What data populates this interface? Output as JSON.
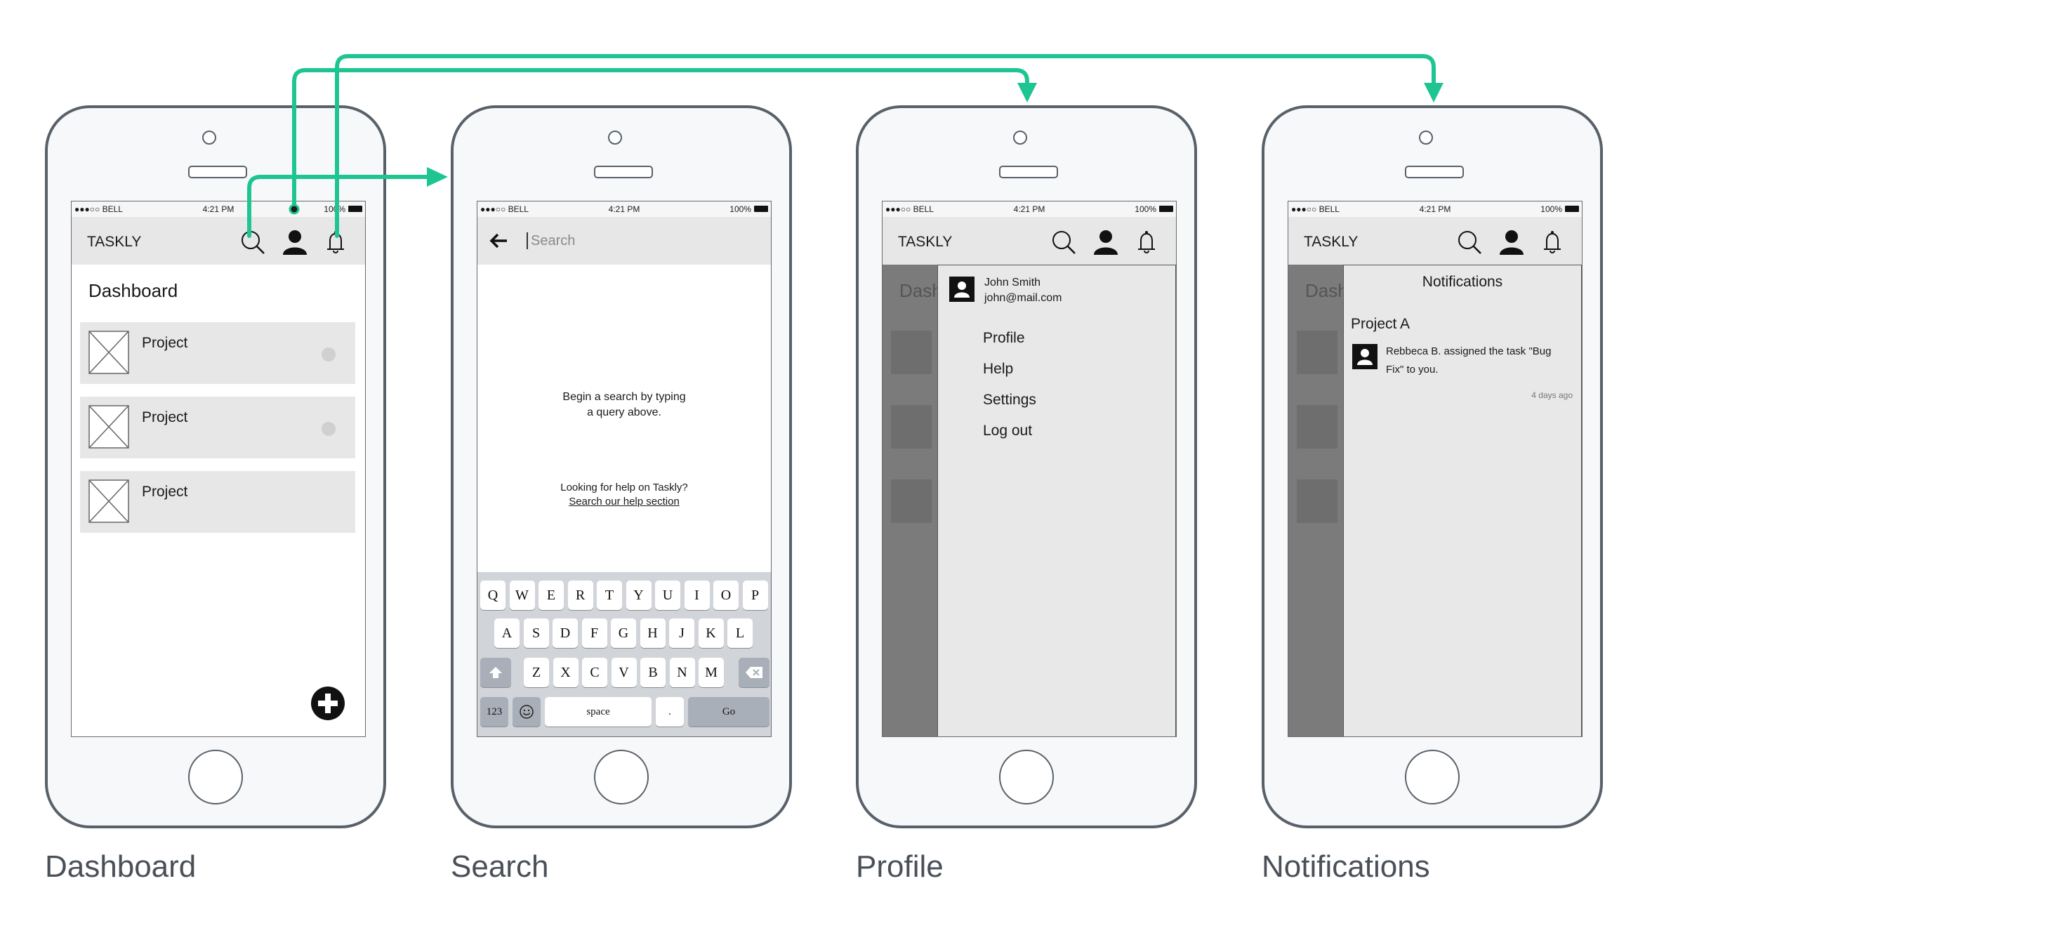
{
  "colors": {
    "flow_arrow": "#1ec592",
    "phone_frame": "#58616a",
    "appbar": "#e7e7e7"
  },
  "status": {
    "carrier": "●●●○○ BELL",
    "time": "4:21 PM",
    "battery": "100%"
  },
  "appbar": {
    "brand": "TASKLY"
  },
  "icons": [
    "search-icon",
    "user-icon",
    "bell-icon",
    "back-arrow-icon",
    "add-icon",
    "image-placeholder-icon",
    "shift-icon",
    "backspace-icon",
    "emoji-icon"
  ],
  "screens": [
    {
      "caption": "Dashboard",
      "title": "Dashboard",
      "projects": [
        {
          "label": "Project"
        },
        {
          "label": "Project"
        },
        {
          "label": "Project"
        }
      ]
    },
    {
      "caption": "Search",
      "search_placeholder": "Search",
      "empty_line1": "Begin a search by typing",
      "empty_line2": "a query above.",
      "help_line": "Looking for help on Taskly?",
      "help_link": "Search our help section",
      "keyboard": {
        "row1": [
          "Q",
          "W",
          "E",
          "R",
          "T",
          "Y",
          "U",
          "I",
          "O",
          "P"
        ],
        "row2": [
          "A",
          "S",
          "D",
          "F",
          "G",
          "H",
          "J",
          "K",
          "L"
        ],
        "row3": [
          "Z",
          "X",
          "C",
          "V",
          "B",
          "N",
          "M"
        ],
        "num_key": "123",
        "space_key": "space",
        "period_key": ".",
        "go_key": "Go"
      }
    },
    {
      "caption": "Profile",
      "background_title": "Dash",
      "user_name": "John Smith",
      "user_email": "john@mail.com",
      "menu": [
        "Profile",
        "Help",
        "Settings",
        "Log out"
      ]
    },
    {
      "caption": "Notifications",
      "background_title": "Dash",
      "panel_title": "Notifications",
      "group": "Project A",
      "notification_line1": "Rebbeca B. assigned the task \"Bug",
      "notification_line2": "Fix\" to you.",
      "time_ago": "4 days ago"
    }
  ]
}
